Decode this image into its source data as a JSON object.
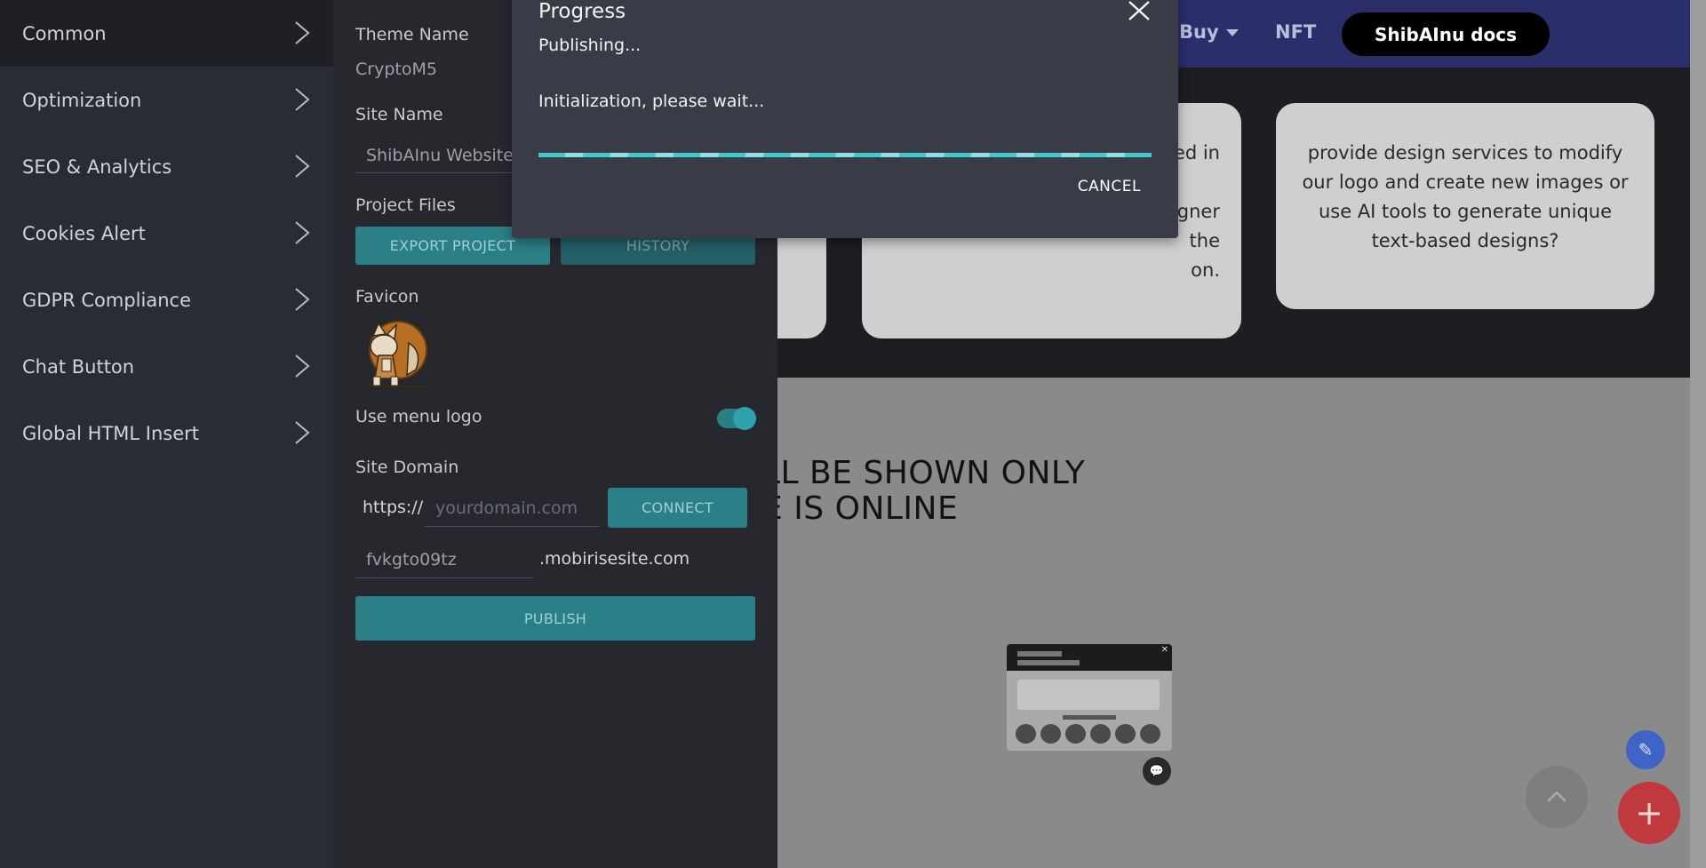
{
  "site": {
    "nav": {
      "buy": "Buy",
      "nft": "NFT",
      "docs": "ShibAInu docs"
    },
    "cards": {
      "c2_lines": [
        "ed in",
        "gner",
        "the",
        "on."
      ],
      "c3_text": "provide design services to modify our logo and create new images or use AI tools to generate unique text-based designs?"
    },
    "hero_lines": [
      "LL BE SHOWN ONLY",
      "E IS ONLINE"
    ]
  },
  "menu": {
    "items": [
      {
        "label": "Common"
      },
      {
        "label": "Optimization"
      },
      {
        "label": "SEO & Analytics"
      },
      {
        "label": "Cookies Alert"
      },
      {
        "label": "GDPR Compliance"
      },
      {
        "label": "Chat Button"
      },
      {
        "label": "Global HTML Insert"
      }
    ]
  },
  "panel": {
    "theme_name_label": "Theme Name",
    "theme_name_value": "CryptoM5",
    "site_name_label": "Site Name",
    "site_name_value": "ShibAInu Website",
    "project_files_label": "Project Files",
    "export_button": "EXPORT PROJECT",
    "history_button": "HISTORY",
    "favicon_label": "Favicon",
    "use_menu_logo_label": "Use menu logo",
    "use_menu_logo_on": true,
    "site_domain_label": "Site Domain",
    "domain_prefix": "https://",
    "domain_placeholder": "yourdomain.com",
    "connect_button": "CONNECT",
    "subdomain_value": "fvkgto09tz",
    "subdomain_suffix": ".mobirisesite.com",
    "publish_button": "PUBLISH"
  },
  "modal": {
    "title": "Progress",
    "status": "Publishing...",
    "detail": "Initialization, please wait...",
    "cancel": "CANCEL"
  },
  "colors": {
    "accent": "#2b7f86",
    "progress": "#2fb6bf",
    "fab_add": "#c0393d",
    "fab_edit": "#3f63c6"
  }
}
